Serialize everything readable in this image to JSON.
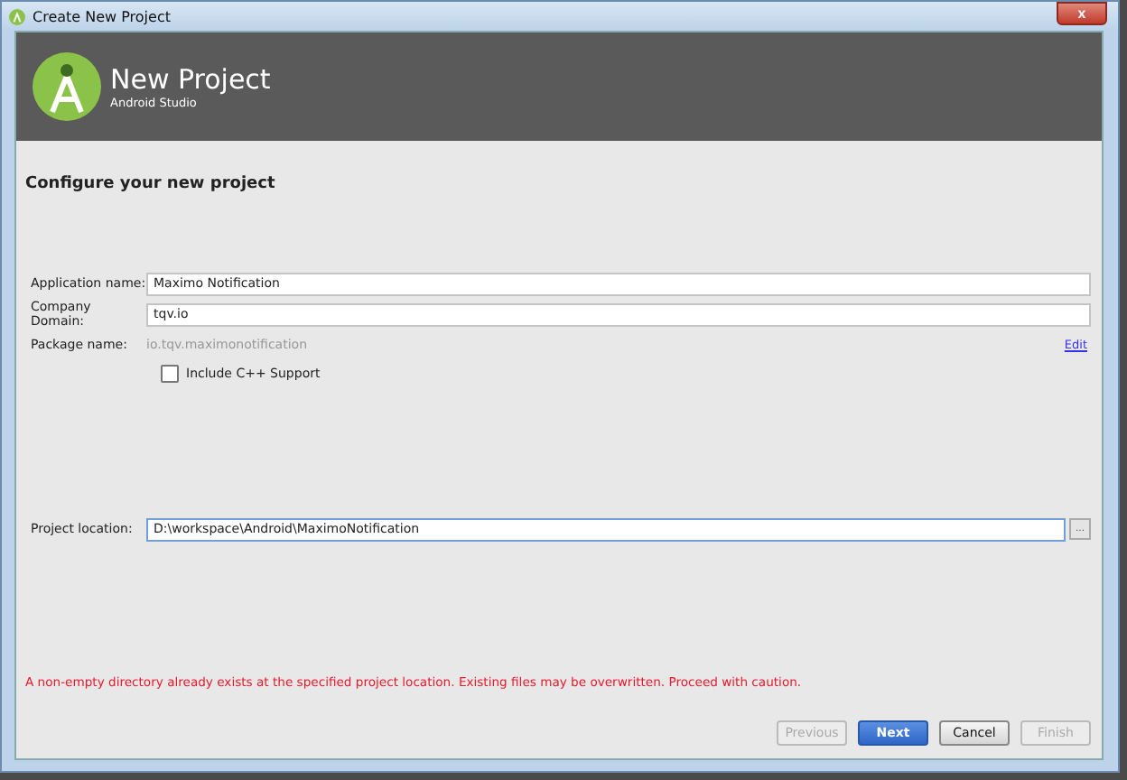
{
  "window": {
    "title": "Create New Project",
    "close": "x"
  },
  "header": {
    "title": "New Project",
    "subtitle": "Android Studio"
  },
  "page_title": "Configure your new project",
  "fields": [
    {
      "kind": "input",
      "label": "Application name:",
      "value": "Maximo Notification",
      "focused": false
    },
    {
      "kind": "input",
      "label": "Company Domain:",
      "value": "tqv.io",
      "focused": false
    },
    {
      "kind": "readonly",
      "label": "Package name:",
      "value": "io.tqv.maximonotification",
      "link": "Edit"
    }
  ],
  "include_cpp": {
    "label": "Include C++ Support",
    "checked": false
  },
  "project_location": {
    "label": "Project location:",
    "value": "D:\\workspace\\Android\\MaximoNotification",
    "focused": true,
    "browse": "..."
  },
  "warning": "A non-empty directory already exists at the specified project location. Existing files may be overwritten. Proceed with caution.",
  "buttons": [
    {
      "label": "Previous",
      "disabled": true,
      "primary": false
    },
    {
      "label": "Next",
      "disabled": false,
      "primary": true
    },
    {
      "label": "Cancel",
      "disabled": false,
      "primary": false
    },
    {
      "label": "Finish",
      "disabled": true,
      "primary": false
    }
  ]
}
